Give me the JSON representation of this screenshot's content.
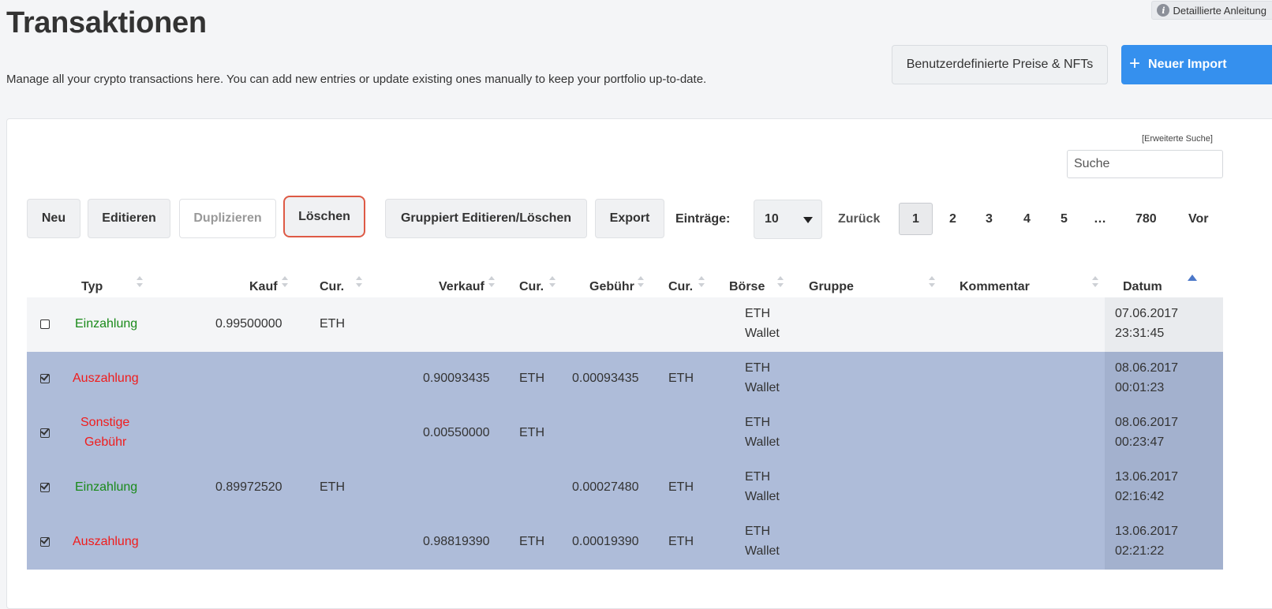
{
  "page": {
    "title": "Transaktionen",
    "subtitle": "Manage all your crypto transactions here. You can add new entries or update existing ones manually to keep your portfolio up-to-date.",
    "help_link": "Detaillierte Anleitung",
    "help_icon": "info-icon",
    "custom_prices_button": "Benutzerdefinierte Preise & NFTs",
    "new_import_button": "Neuer Import",
    "new_import_icon": "+"
  },
  "search": {
    "advanced_link": "[Erweiterte Suche]",
    "placeholder": "Suche"
  },
  "toolbar": {
    "new": "Neu",
    "edit": "Editieren",
    "duplicate": "Duplizieren",
    "delete": "Löschen",
    "group_edit": "Gruppiert Editieren/Löschen",
    "export": "Export",
    "entries_label": "Einträge:",
    "entries_value": "10"
  },
  "pagination": {
    "prev": "Zurück",
    "pages": [
      "1",
      "2",
      "3",
      "4",
      "5",
      "…",
      "780"
    ],
    "active": "1",
    "next": "Vor"
  },
  "table": {
    "headers": [
      "Typ",
      "Kauf",
      "Cur.",
      "Verkauf",
      "Cur.",
      "Gebühr",
      "Cur.",
      "Börse",
      "Gruppe",
      "Kommentar",
      "Datum"
    ],
    "rows": [
      {
        "checked": false,
        "type": "Einzahlung",
        "type_color": "green",
        "buy": "0.99500000",
        "buy_cur": "ETH",
        "sell": "",
        "sell_cur": "",
        "fee": "",
        "fee_cur": "",
        "exchange": "ETH",
        "exchange2": "Wallet",
        "group": "",
        "comment": "",
        "date": "07.06.2017",
        "time": "23:31:45"
      },
      {
        "checked": true,
        "type": "Auszahlung",
        "type_color": "red",
        "buy": "",
        "buy_cur": "",
        "sell": "0.90093435",
        "sell_cur": "ETH",
        "fee": "0.00093435",
        "fee_cur": "ETH",
        "exchange": "ETH",
        "exchange2": "Wallet",
        "group": "",
        "comment": "",
        "date": "08.06.2017",
        "time": "00:01:23"
      },
      {
        "checked": true,
        "type": "Sonstige",
        "type2": "Gebühr",
        "type_color": "red",
        "buy": "",
        "buy_cur": "",
        "sell": "0.00550000",
        "sell_cur": "ETH",
        "fee": "",
        "fee_cur": "",
        "exchange": "ETH",
        "exchange2": "Wallet",
        "group": "",
        "comment": "",
        "date": "08.06.2017",
        "time": "00:23:47"
      },
      {
        "checked": true,
        "type": "Einzahlung",
        "type_color": "green",
        "buy": "0.89972520",
        "buy_cur": "ETH",
        "sell": "",
        "sell_cur": "",
        "fee": "0.00027480",
        "fee_cur": "ETH",
        "exchange": "ETH",
        "exchange2": "Wallet",
        "group": "",
        "comment": "",
        "date": "13.06.2017",
        "time": "02:16:42"
      },
      {
        "checked": true,
        "type": "Auszahlung",
        "type_color": "red",
        "buy": "",
        "buy_cur": "",
        "sell": "0.98819390",
        "sell_cur": "ETH",
        "fee": "0.00019390",
        "fee_cur": "ETH",
        "exchange": "ETH",
        "exchange2": "Wallet",
        "group": "",
        "comment": "",
        "date": "13.06.2017",
        "time": "02:21:22"
      }
    ]
  }
}
